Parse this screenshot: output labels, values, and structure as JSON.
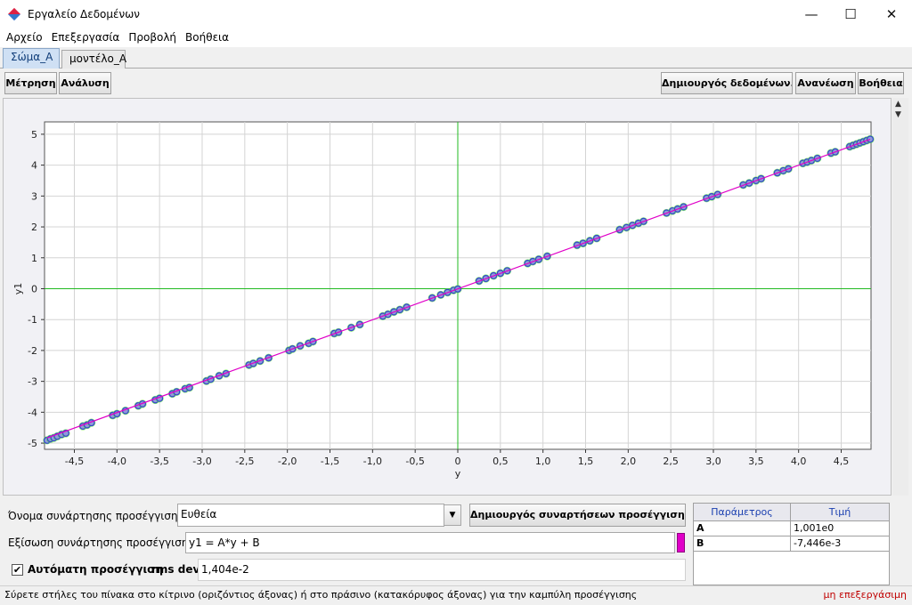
{
  "window": {
    "title": "Εργαλείο Δεδομένων"
  },
  "menu": [
    "Αρχείο",
    "Επεξεργασία",
    "Προβολή",
    "Βοήθεια"
  ],
  "tabs": [
    {
      "label": "Σώμα_Α",
      "active": true
    },
    {
      "label": "μοντέλο_Α",
      "active": false
    }
  ],
  "toolbar": {
    "measure": "Μέτρηση",
    "analysis": "Ανάλυση",
    "data_builder": "Δημιουργός δεδομένων...",
    "refresh": "Ανανέωση",
    "help": "Βοήθεια"
  },
  "fit": {
    "name_label": "Όνομα συνάρτησης προσέγγισης:",
    "name_value": "Ευθεία",
    "builder_button": "Δημιουργός συναρτήσεων προσέγγισης...",
    "equation_label": "Εξίσωση συνάρτησης προσέγγισης:",
    "equation_value": "y1 = A*y + B",
    "auto_label": "Αυτόματη προσέγγιση",
    "auto_checked": true,
    "rms_label": "rms dev:",
    "rms_value": "1,404e-2",
    "line_color": "#e000c8"
  },
  "params": {
    "headers": [
      "Παράμετρος",
      "Τιμή"
    ],
    "rows": [
      {
        "name": "A",
        "value": "1,001e0"
      },
      {
        "name": "B",
        "value": "-7,446e-3"
      }
    ]
  },
  "status": {
    "hint": "Σύρετε στήλες του πίνακα στο κίτρινο (οριζόντιος άξονας) ή στο πράσινο (κατακόρυφος άξονας) για την καμπύλη προσέγγισης",
    "state": "μη επεξεργάσιμη"
  },
  "chart_data": {
    "type": "scatter",
    "xlabel": "y",
    "ylabel": "y1",
    "xlim": [
      -4.85,
      4.85
    ],
    "ylim": [
      -5.2,
      5.4
    ],
    "x_ticks": [
      "-4,5",
      "-4,0",
      "-3,5",
      "-3,0",
      "-2,5",
      "-2,0",
      "-1,5",
      "-1,0",
      "-0,5",
      "0",
      "0,5",
      "1,0",
      "1,5",
      "2,0",
      "2,5",
      "3,0",
      "3,5",
      "4,0",
      "4,5"
    ],
    "x_tick_values": [
      -4.5,
      -4.0,
      -3.5,
      -3.0,
      -2.5,
      -2.0,
      -1.5,
      -1.0,
      -0.5,
      0,
      0.5,
      1.0,
      1.5,
      2.0,
      2.5,
      3.0,
      3.5,
      4.0,
      4.5
    ],
    "y_ticks": [
      "-5",
      "-4",
      "-3",
      "-2",
      "-1",
      "0",
      "1",
      "2",
      "3",
      "4",
      "5"
    ],
    "y_tick_values": [
      -5,
      -4,
      -3,
      -2,
      -1,
      0,
      1,
      2,
      3,
      4,
      5
    ],
    "grid": true,
    "point_color": "#3344cc",
    "point_halo_color": "#66ee44",
    "fit_color": "#e000c8",
    "axis_zero_color": "#22bb22",
    "fit_line": {
      "A": 1.001,
      "B": -0.007446
    },
    "points": [
      [
        -4.82,
        -4.91
      ],
      [
        -4.78,
        -4.86
      ],
      [
        -4.74,
        -4.83
      ],
      [
        -4.7,
        -4.78
      ],
      [
        -4.65,
        -4.72
      ],
      [
        -4.6,
        -4.68
      ],
      [
        -4.4,
        -4.45
      ],
      [
        -4.35,
        -4.41
      ],
      [
        -4.3,
        -4.34
      ],
      [
        -4.05,
        -4.1
      ],
      [
        -4.0,
        -4.05
      ],
      [
        -3.9,
        -3.95
      ],
      [
        -3.75,
        -3.79
      ],
      [
        -3.7,
        -3.73
      ],
      [
        -3.55,
        -3.6
      ],
      [
        -3.5,
        -3.55
      ],
      [
        -3.35,
        -3.4
      ],
      [
        -3.3,
        -3.34
      ],
      [
        -3.2,
        -3.24
      ],
      [
        -3.15,
        -3.2
      ],
      [
        -2.95,
        -2.99
      ],
      [
        -2.9,
        -2.93
      ],
      [
        -2.8,
        -2.82
      ],
      [
        -2.72,
        -2.75
      ],
      [
        -2.45,
        -2.47
      ],
      [
        -2.4,
        -2.42
      ],
      [
        -2.32,
        -2.34
      ],
      [
        -2.22,
        -2.24
      ],
      [
        -1.98,
        -2.0
      ],
      [
        -1.94,
        -1.95
      ],
      [
        -1.85,
        -1.85
      ],
      [
        -1.75,
        -1.77
      ],
      [
        -1.7,
        -1.71
      ],
      [
        -1.45,
        -1.45
      ],
      [
        -1.4,
        -1.41
      ],
      [
        -1.25,
        -1.26
      ],
      [
        -1.15,
        -1.16
      ],
      [
        -0.88,
        -0.89
      ],
      [
        -0.82,
        -0.83
      ],
      [
        -0.75,
        -0.75
      ],
      [
        -0.68,
        -0.68
      ],
      [
        -0.6,
        -0.6
      ],
      [
        -0.3,
        -0.3
      ],
      [
        -0.2,
        -0.2
      ],
      [
        -0.12,
        -0.12
      ],
      [
        -0.05,
        -0.05
      ],
      [
        0.0,
        -0.01
      ],
      [
        0.25,
        0.25
      ],
      [
        0.33,
        0.33
      ],
      [
        0.42,
        0.42
      ],
      [
        0.5,
        0.5
      ],
      [
        0.58,
        0.58
      ],
      [
        0.82,
        0.82
      ],
      [
        0.88,
        0.88
      ],
      [
        0.95,
        0.95
      ],
      [
        1.05,
        1.05
      ],
      [
        1.4,
        1.41
      ],
      [
        1.47,
        1.47
      ],
      [
        1.55,
        1.55
      ],
      [
        1.63,
        1.63
      ],
      [
        1.9,
        1.91
      ],
      [
        1.98,
        1.98
      ],
      [
        2.05,
        2.05
      ],
      [
        2.12,
        2.12
      ],
      [
        2.18,
        2.18
      ],
      [
        2.45,
        2.45
      ],
      [
        2.52,
        2.52
      ],
      [
        2.58,
        2.58
      ],
      [
        2.65,
        2.65
      ],
      [
        2.92,
        2.93
      ],
      [
        2.98,
        2.98
      ],
      [
        3.05,
        3.05
      ],
      [
        3.35,
        3.36
      ],
      [
        3.42,
        3.42
      ],
      [
        3.5,
        3.5
      ],
      [
        3.56,
        3.56
      ],
      [
        3.75,
        3.75
      ],
      [
        3.82,
        3.82
      ],
      [
        3.88,
        3.88
      ],
      [
        4.05,
        4.06
      ],
      [
        4.1,
        4.1
      ],
      [
        4.15,
        4.15
      ],
      [
        4.22,
        4.22
      ],
      [
        4.38,
        4.39
      ],
      [
        4.43,
        4.43
      ],
      [
        4.6,
        4.6
      ],
      [
        4.64,
        4.64
      ],
      [
        4.68,
        4.68
      ],
      [
        4.72,
        4.72
      ],
      [
        4.76,
        4.76
      ],
      [
        4.8,
        4.8
      ],
      [
        4.84,
        4.84
      ]
    ]
  }
}
